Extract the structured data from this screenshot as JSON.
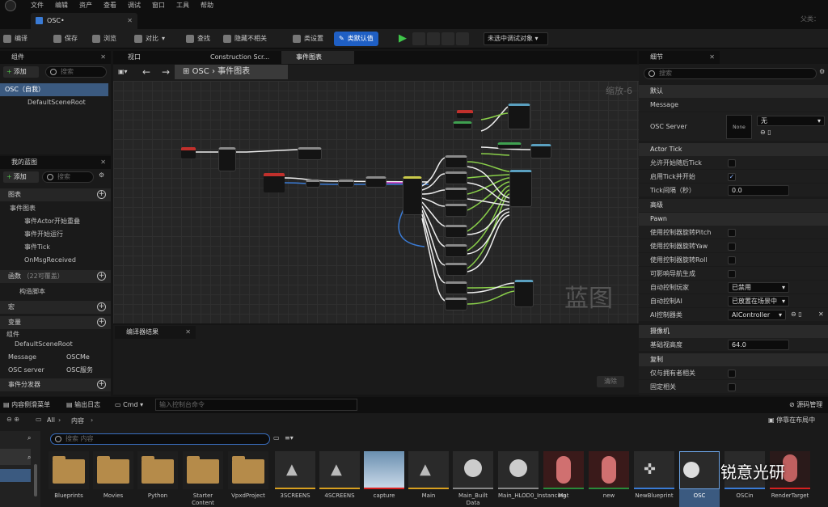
{
  "menu": [
    "文件",
    "编辑",
    "资产",
    "查看",
    "调试",
    "窗口",
    "工具",
    "帮助"
  ],
  "doc_tab": "OSC•",
  "parent_label": "父类：",
  "toolbar": {
    "compile": "编译",
    "save": "保存",
    "browse": "浏览",
    "diff": "对比",
    "find": "查找",
    "hide": "隐藏不相关",
    "class_settings": "类设置",
    "class_defaults": "类默认值",
    "debug_object": "未选中调试对象"
  },
  "components": {
    "title": "组件",
    "add": "添加",
    "search_placeholder": "搜索",
    "root": "OSC（自我）",
    "child": "DefaultSceneRoot"
  },
  "my_blueprint": {
    "title": "我的蓝图",
    "add": "添加",
    "search_placeholder": "搜索",
    "graphs_header": "图表",
    "event_graph": "事件图表",
    "events": [
      "事件Actor开始重叠",
      "事件开始运行",
      "事件Tick",
      "OnMsgReceived"
    ],
    "functions_header": "函数",
    "functions_count": "（22可覆盖）",
    "construction": "构造脚本",
    "macros_header": "宏",
    "variables_header": "变量",
    "components_header": "组件",
    "variables": [
      {
        "name": "DefaultSceneRoot",
        "type": ""
      },
      {
        "name": "Message",
        "type": "OSCMe"
      },
      {
        "name": "OSC server",
        "type": "OSC服务"
      }
    ],
    "dispatchers_header": "事件分发器"
  },
  "graph_tabs": {
    "viewport": "视口",
    "construction": "Construction Scr...",
    "event_graph": "事件图表"
  },
  "breadcrumb": {
    "root": "OSC",
    "current": "事件图表"
  },
  "zoom": "缩放-6",
  "watermark": "蓝图",
  "compiler": {
    "title": "编译器结果",
    "clear": "清除"
  },
  "details": {
    "title": "细节",
    "search_placeholder": "搜索",
    "sec_default": "默认",
    "message": "Message",
    "osc_server": "OSC Server",
    "none_thumb": "None",
    "none_value": "无",
    "sec_actor_tick": "Actor Tick",
    "tick_start": "允许开始随后Tick",
    "tick_enabled": "启用Tick并开始",
    "tick_interval": "Tick间隔（秒）",
    "tick_interval_value": "0.0",
    "sec_advanced": "高级",
    "sec_pawn": "Pawn",
    "pitch": "使用控制器旋转Pitch",
    "yaw": "使用控制器旋转Yaw",
    "roll": "使用控制器旋转Roll",
    "nav": "可影响导航生成",
    "auto_player": "自动控制玩家",
    "auto_player_value": "已禁用",
    "auto_ai": "自动控制AI",
    "auto_ai_value": "已放置在场景中",
    "ai_class": "AI控制器类",
    "ai_class_value": "AIController",
    "sec_camera": "摄像机",
    "eye_height": "基础视高度",
    "eye_height_value": "64.0",
    "sec_replication": "复制",
    "only_owner": "仅与拥有者相关",
    "always_relevant": "固定相关"
  },
  "bottom_tabs": {
    "content_drawer": "内容侧滑菜单",
    "output_log": "输出日志",
    "cmd": "Cmd",
    "cmd_placeholder": "输入控制台命令",
    "source_control": "源码管理"
  },
  "content": {
    "path_all": "All",
    "path_content": "内容",
    "dock": "停靠在布局中",
    "search_placeholder": "搜索 内容"
  },
  "assets": [
    "Blueprints",
    "Movies",
    "Python",
    "Starter Content",
    "VpxdProject",
    "3SCREENS",
    "4SCREENS",
    "capture",
    "Main",
    "Main_Built Data",
    "Main_HLOD0_Instancing",
    "Mat",
    "new",
    "NewBlueprint",
    "OSC",
    "OSCin",
    "RenderTarget"
  ],
  "wechat_watermark": "锐意光研",
  "colors": {
    "accent": "#1f5fc4",
    "play": "#3fc64a",
    "selected": "#3b5a80"
  }
}
